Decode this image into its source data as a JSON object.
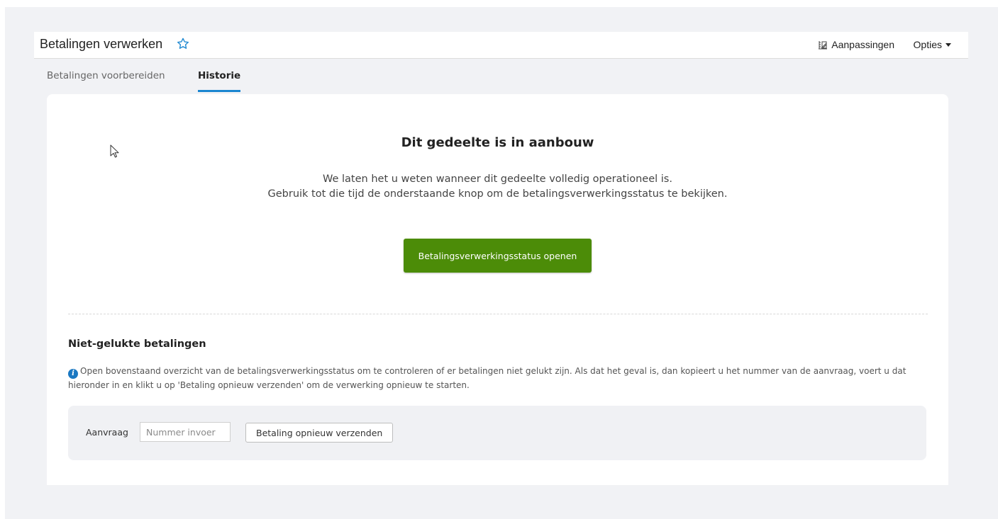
{
  "header": {
    "title": "Betalingen verwerken",
    "favorite_icon": "star-outline-icon",
    "customize_label": "Aanpassingen",
    "customize_icon": "customize-chart-icon",
    "options_label": "Opties"
  },
  "tabs": [
    {
      "label": "Betalingen voorbereiden",
      "active": false
    },
    {
      "label": "Historie",
      "active": true
    }
  ],
  "notice": {
    "heading": "Dit gedeelte is in aanbouw",
    "line1": "We laten het u weten wanneer dit gedeelte volledig operationeel is.",
    "line2": "Gebruik tot die tijd de onderstaande knop om de betalingsverwerkingsstatus te bekijken.",
    "button_label": "Betalingsverwerkingsstatus openen"
  },
  "failed": {
    "title": "Niet-gelukte betalingen",
    "info_text": "Open bovenstaand overzicht van de betalingsverwerkingsstatus om te controleren of er betalingen niet gelukt zijn. Als dat het geval is, dan kopieert u het nummer van de aanvraag, voert u dat hieronder in en klikt u op 'Betaling opnieuw verzenden' om de verwerking opnieuw te starten.",
    "request_label": "Aanvraag",
    "input_placeholder": "Nummer invoer",
    "input_value": "",
    "resend_label": "Betaling opnieuw verzenden"
  },
  "colors": {
    "accent_blue": "#1a86d0",
    "primary_green": "#4c8c08",
    "page_bg": "#f1f2f5"
  }
}
